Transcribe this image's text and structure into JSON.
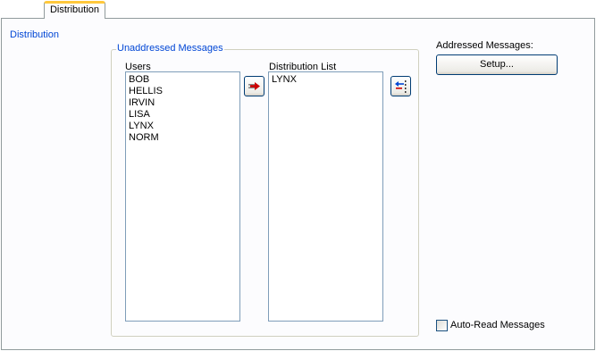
{
  "tab": {
    "label": "Distribution"
  },
  "section": {
    "title": "Distribution"
  },
  "unaddressed": {
    "group_title": "Unaddressed Messages",
    "users_label": "Users",
    "users": [
      "BOB",
      "HELLIS",
      "IRVIN",
      "LISA",
      "LYNX",
      "NORM"
    ],
    "distribution_label": "Distribution List",
    "distribution": [
      "LYNX"
    ]
  },
  "addressed": {
    "label": "Addressed Messages:",
    "setup_button": "Setup..."
  },
  "options": {
    "auto_read_label": "Auto-Read Messages",
    "auto_read_checked": false
  },
  "icons": {
    "add": "arrow-right-icon",
    "remove": "arrow-left-icon"
  },
  "colors": {
    "group_title": "#0046d5",
    "tab_highlight": "#ffc83c",
    "arrow": "#cc0000"
  }
}
